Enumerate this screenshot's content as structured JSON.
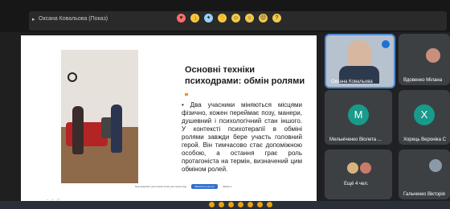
{
  "meeting": {
    "presenter_label": "Оксана Ковальова (Показ)",
    "reactions_colors": [
      "#ff6b6b",
      "#f3c94a",
      "#9ad2ff",
      "#f3c94a",
      "#f3c94a",
      "#f3c94a",
      "#f3c94a",
      "#f3c94a"
    ]
  },
  "slide": {
    "title": "Основні техніки психодрами: обмін ролями",
    "bullet": "• Два учасники міняються місцями фізично, кожен переймає позу, манери, душевний і психологічний стан іншого. У контексті психотерапії в обміні ролями завжди бере участь головний герой. Він тимчасово стає допоміжною особою, а остання грає роль протагоніста на термін, визначений цим обміном ролей.",
    "notice": "Цей документ доступний лише для перегляду",
    "notice_button": "Запросити доступ",
    "notice_dismiss": "Закрити"
  },
  "participants": {
    "presenter": "Оксана Ковальова",
    "p2": "Вдовенко Мілана",
    "p3_initial": "M",
    "p3": "Мельніченко Віолета ...",
    "p4_initial": "X",
    "p4": "Хорець Вероніка С",
    "more": "Ещё 4 чел.",
    "p6": "Гальченко Вікторія"
  },
  "colors": {
    "avatar_m": "#1a9a8a",
    "avatar_x": "#1a9a8a",
    "accent": "#f28c28"
  }
}
